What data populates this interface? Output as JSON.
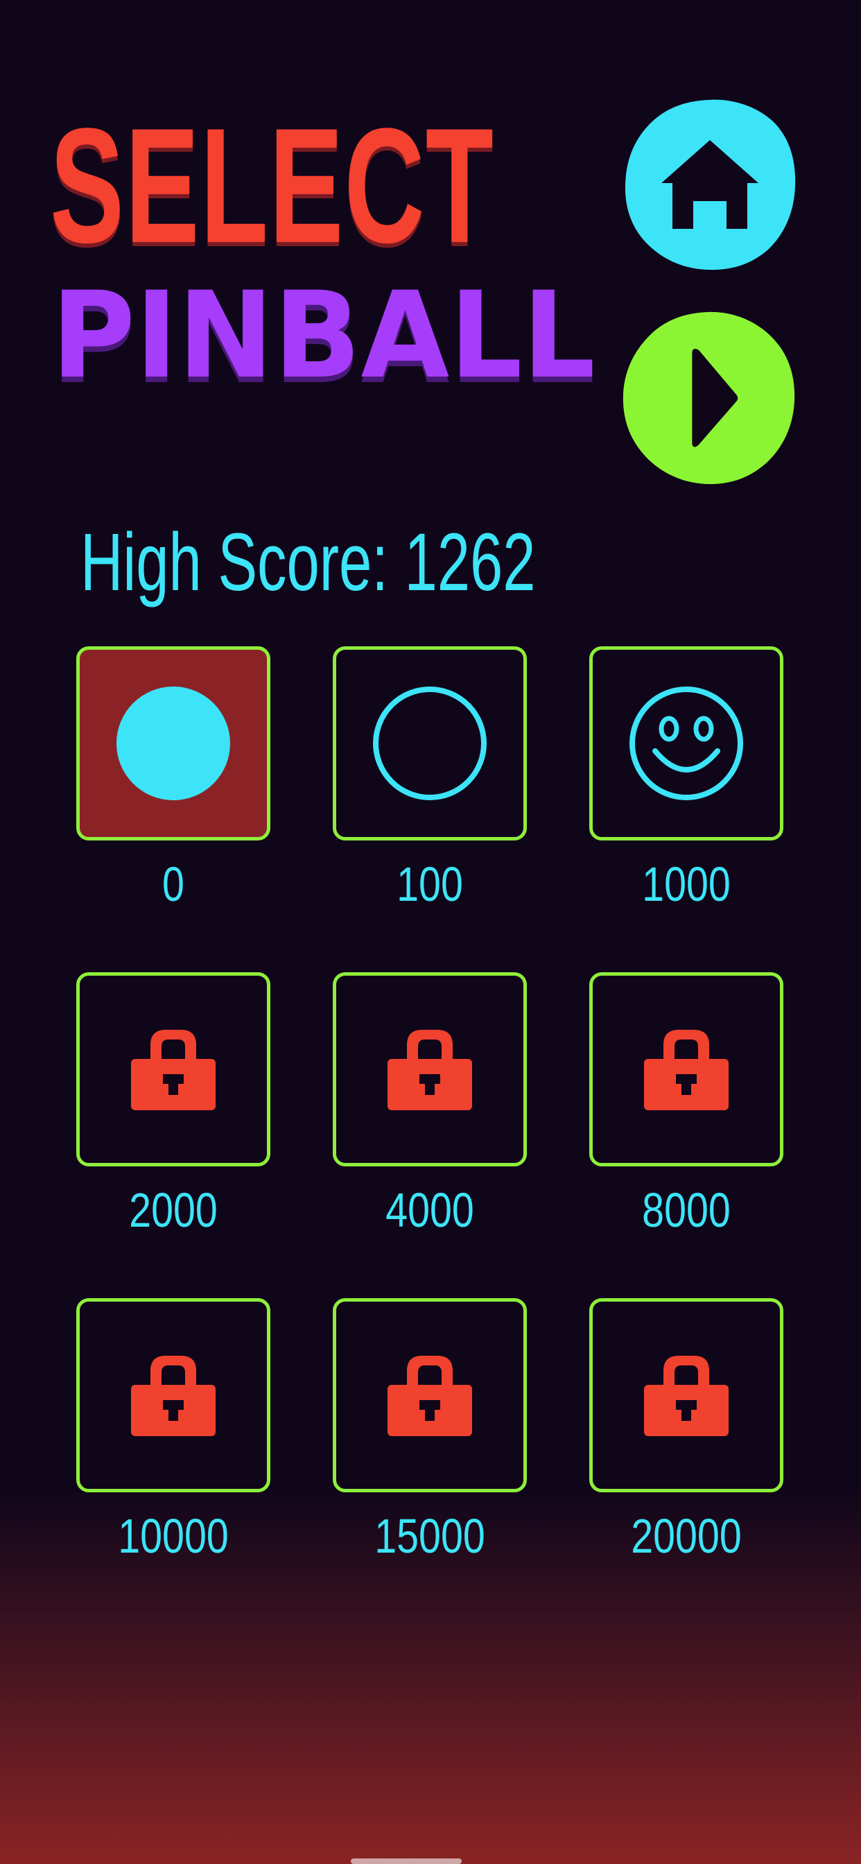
{
  "title": {
    "line1": "SELECT",
    "line2": "PINBALL"
  },
  "buttons": {
    "home": {
      "icon": "home-icon",
      "color": "#3de4f7"
    },
    "play": {
      "icon": "play-icon",
      "color": "#8cf533"
    }
  },
  "high_score": {
    "text": "High Score: 1262"
  },
  "colors": {
    "background": "#10061a",
    "select_red": "#f5412f",
    "pinball_purple": "#a63dfa",
    "cyan": "#3de4f7",
    "green_border": "#8eef3a",
    "lock_red": "#f0422e",
    "selected_tile": "#8b2326"
  },
  "balls": [
    {
      "icon": "filled-ball-icon",
      "cost": "0",
      "selected": true,
      "locked": false
    },
    {
      "icon": "ring-ball-icon",
      "cost": "100",
      "selected": false,
      "locked": false
    },
    {
      "icon": "smiley-ball-icon",
      "cost": "1000",
      "selected": false,
      "locked": false
    },
    {
      "icon": "lock-icon",
      "cost": "2000",
      "selected": false,
      "locked": true
    },
    {
      "icon": "lock-icon",
      "cost": "4000",
      "selected": false,
      "locked": true
    },
    {
      "icon": "lock-icon",
      "cost": "8000",
      "selected": false,
      "locked": true
    },
    {
      "icon": "lock-icon",
      "cost": "10000",
      "selected": false,
      "locked": true
    },
    {
      "icon": "lock-icon",
      "cost": "15000",
      "selected": false,
      "locked": true
    },
    {
      "icon": "lock-icon",
      "cost": "20000",
      "selected": false,
      "locked": true
    }
  ]
}
